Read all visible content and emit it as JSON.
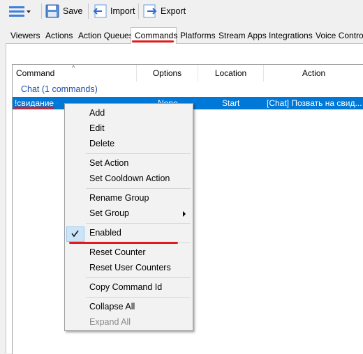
{
  "toolbar": {
    "save_label": "Save",
    "import_label": "Import",
    "export_label": "Export"
  },
  "tabs": [
    {
      "label": "Viewers"
    },
    {
      "label": "Actions"
    },
    {
      "label": "Action Queues"
    },
    {
      "label": "Commands",
      "active": true
    },
    {
      "label": "Platforms"
    },
    {
      "label": "Stream Apps"
    },
    {
      "label": "Integrations"
    },
    {
      "label": "Voice Control"
    }
  ],
  "list": {
    "columns": [
      "Command",
      "Options",
      "Location",
      "Action"
    ],
    "group_header": "Chat (1 commands)",
    "row": {
      "command": "!свидание",
      "options": "None",
      "location": "Start",
      "action": "[Chat] Позвать на свид..."
    }
  },
  "context_menu": {
    "items": [
      {
        "label": "Add"
      },
      {
        "label": "Edit"
      },
      {
        "label": "Delete"
      },
      {
        "label": "Set Action"
      },
      {
        "label": "Set Cooldown Action"
      },
      {
        "label": "Rename Group"
      },
      {
        "label": "Set Group",
        "submenu": true
      },
      {
        "label": "Enabled",
        "checked": true
      },
      {
        "label": "Reset Counter"
      },
      {
        "label": "Reset User Counters"
      },
      {
        "label": "Copy Command Id"
      },
      {
        "label": "Collapse All"
      },
      {
        "label": "Expand All",
        "disabled": true
      }
    ]
  },
  "colors": {
    "selection": "#0078d7",
    "group_header_text": "#1e4fa8",
    "annotation_red": "#e01b1b",
    "icon_blue": "#3d7fd9"
  },
  "icons": [
    "menu-icon",
    "dropdown-arrow-icon",
    "floppy-disk-icon",
    "import-arrow-icon",
    "export-arrow-icon",
    "sort-up-icon",
    "checkmark-icon",
    "submenu-arrow-icon"
  ]
}
